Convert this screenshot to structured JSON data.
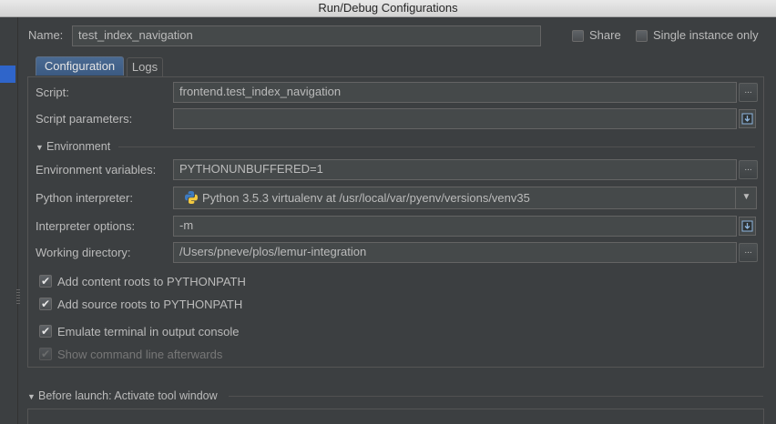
{
  "window": {
    "title": "Run/Debug Configurations"
  },
  "header": {
    "name_label": "Name:",
    "name_value": "test_index_navigation",
    "share_label": "Share",
    "single_instance_label": "Single instance only"
  },
  "tabs": [
    {
      "label": "Configuration",
      "active": true
    },
    {
      "label": "Logs",
      "active": false
    }
  ],
  "config": {
    "script_label": "Script:",
    "script_value": "frontend.test_index_navigation",
    "script_params_label": "Script parameters:",
    "script_params_value": "",
    "environment_section": "Environment",
    "env_vars_label": "Environment variables:",
    "env_vars_value": "PYTHONUNBUFFERED=1",
    "interpreter_label": "Python interpreter:",
    "interpreter_value": "Python 3.5.3 virtualenv at /usr/local/var/pyenv/versions/venv35",
    "interp_options_label": "Interpreter options:",
    "interp_options_value": "-m",
    "workdir_label": "Working directory:",
    "workdir_value": "/Users/pneve/plos/lemur-integration",
    "browse_button": "...",
    "checkboxes": [
      {
        "label": "Add content roots to PYTHONPATH",
        "checked": true,
        "enabled": true
      },
      {
        "label": "Add source roots to PYTHONPATH",
        "checked": true,
        "enabled": true
      },
      {
        "label": "Emulate terminal in output console",
        "checked": true,
        "enabled": true
      },
      {
        "label": "Show command line afterwards",
        "checked": true,
        "enabled": false
      }
    ]
  },
  "before_launch": {
    "label": "Before launch: Activate tool window"
  },
  "icons": {
    "check": "✔",
    "dropdown": "▼",
    "section_toggle": "▼",
    "python_logo": "python-logo-icon",
    "expand_field": "expand-field-icon"
  },
  "colors": {
    "background": "#3c3f41",
    "field_background": "#45494a",
    "selection": "#2f65ca",
    "active_tab": "#4a6a92"
  }
}
